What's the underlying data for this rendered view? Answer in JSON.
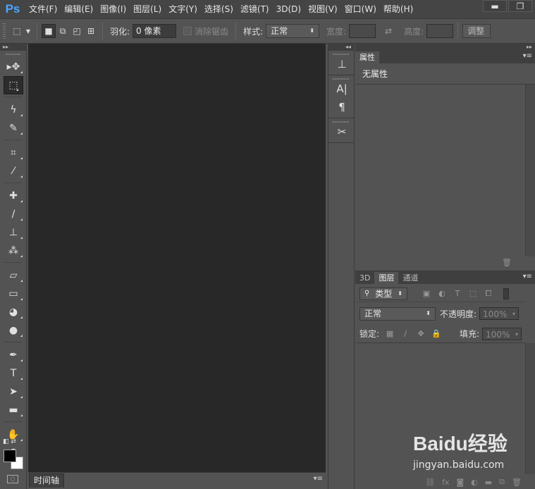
{
  "app": {
    "logo": "Ps"
  },
  "menu": [
    "文件(F)",
    "编辑(E)",
    "图像(I)",
    "图层(L)",
    "文字(Y)",
    "选择(S)",
    "滤镜(T)",
    "3D(D)",
    "视图(V)",
    "窗口(W)",
    "帮助(H)"
  ],
  "window_controls": {
    "minimize": "▬",
    "maximize": "❐",
    "close": "✕"
  },
  "options": {
    "feather_label": "羽化:",
    "feather_value": "0 像素",
    "antialias_label": "消除锯齿",
    "style_label": "样式:",
    "style_value": "正常",
    "width_label": "宽度:",
    "height_label": "高度:",
    "refine_label": "调整"
  },
  "tools": [
    {
      "name": "move-tool",
      "glyph": "▸✥"
    },
    {
      "name": "marquee-tool",
      "glyph": "⬚"
    },
    {
      "name": "lasso-tool",
      "glyph": "ϟ"
    },
    {
      "name": "quick-select-tool",
      "glyph": "✎"
    },
    {
      "name": "crop-tool",
      "glyph": "⌗"
    },
    {
      "name": "eyedropper-tool",
      "glyph": "⁄"
    },
    {
      "name": "healing-tool",
      "glyph": "✚"
    },
    {
      "name": "brush-tool",
      "glyph": "∕"
    },
    {
      "name": "stamp-tool",
      "glyph": "⊥"
    },
    {
      "name": "history-brush-tool",
      "glyph": "⁂"
    },
    {
      "name": "eraser-tool",
      "glyph": "▱"
    },
    {
      "name": "gradient-tool",
      "glyph": "▭"
    },
    {
      "name": "blur-tool",
      "glyph": "◕"
    },
    {
      "name": "dodge-tool",
      "glyph": "●"
    },
    {
      "name": "pen-tool",
      "glyph": "✒"
    },
    {
      "name": "type-tool",
      "glyph": "T"
    },
    {
      "name": "path-select-tool",
      "glyph": "➤"
    },
    {
      "name": "shape-tool",
      "glyph": "▬"
    },
    {
      "name": "hand-tool",
      "glyph": "✋"
    },
    {
      "name": "zoom-tool",
      "glyph": "⚲"
    }
  ],
  "timeline": {
    "tab": "时间轴"
  },
  "properties": {
    "tab": "属性",
    "title": "无属性"
  },
  "layers": {
    "tabs": [
      "3D",
      "图层",
      "通道"
    ],
    "filter_label": "类型",
    "blend_mode": "正常",
    "opacity_label": "不透明度:",
    "opacity_value": "100%",
    "lock_label": "锁定:",
    "fill_label": "填充:",
    "fill_value": "100%"
  },
  "watermark": {
    "logo": "Baidu经验",
    "url": "jingyan.baidu.com"
  },
  "colors": {
    "accent": "#4aa8ff",
    "canvas": "#282828",
    "panel": "#535353"
  }
}
